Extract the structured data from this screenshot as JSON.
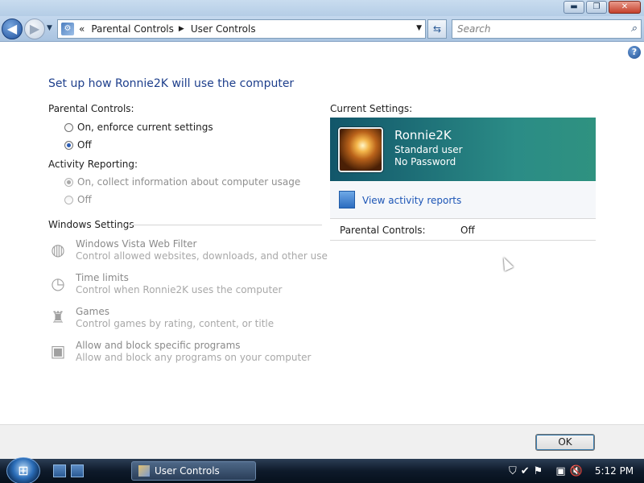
{
  "window": {
    "controls": {
      "minimize": "▬",
      "maximize": "❐",
      "close": "✕"
    }
  },
  "nav": {
    "breadcrumb_prefix": "«",
    "breadcrumb": [
      "Parental Controls",
      "User Controls"
    ],
    "search_placeholder": "Search",
    "back_icon": "arrow-left-icon",
    "forward_icon": "arrow-right-icon"
  },
  "page": {
    "heading": "Set up how Ronnie2K will use the computer",
    "parental_controls_label": "Parental Controls:",
    "parental_on_label": "On, enforce current settings",
    "parental_off_label": "Off",
    "parental_selected": "Off",
    "activity_label": "Activity Reporting:",
    "activity_on_label": "On, collect information about computer usage",
    "activity_off_label": "Off",
    "windows_settings_label": "Windows Settings",
    "settings": [
      {
        "title": "Windows Vista Web Filter",
        "desc": "Control allowed websites, downloads, and other use",
        "icon": "globe-icon"
      },
      {
        "title": "Time limits",
        "desc": "Control when Ronnie2K uses the computer",
        "icon": "clock-icon"
      },
      {
        "title": "Games",
        "desc": "Control games by rating, content, or title",
        "icon": "trophy-icon"
      },
      {
        "title": "Allow and block specific programs",
        "desc": "Allow and block any programs on your computer",
        "icon": "programs-icon"
      }
    ]
  },
  "current": {
    "label": "Current Settings:",
    "user_name": "Ronnie2K",
    "user_type": "Standard user",
    "user_password": "No Password",
    "reports_link": "View activity reports",
    "pc_label": "Parental Controls:",
    "pc_value": "Off"
  },
  "footer": {
    "ok_label": "OK"
  },
  "taskbar": {
    "task_label": "User Controls",
    "clock": "5:12 PM"
  },
  "colors": {
    "heading": "#1e3f8c",
    "card_start": "#12566a",
    "card_end": "#2f9280",
    "link": "#1c55b6"
  }
}
